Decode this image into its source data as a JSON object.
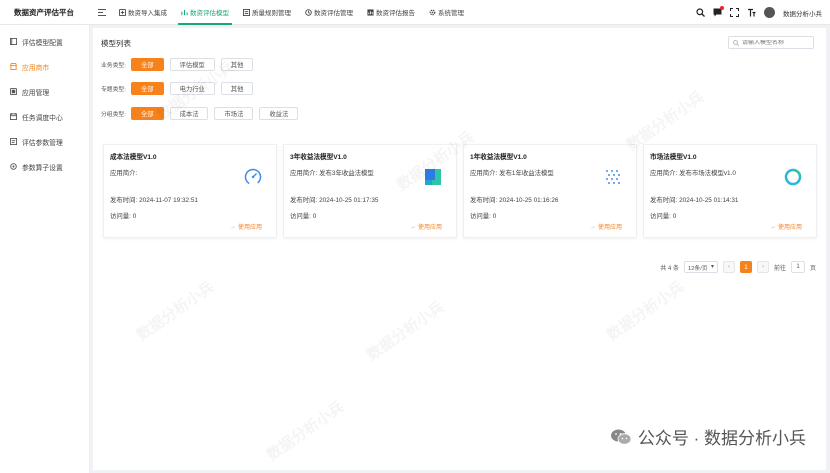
{
  "app": {
    "title": "数据资产评估平台"
  },
  "nav": [
    {
      "label": "数资导入集成",
      "icon": "import-icon"
    },
    {
      "label": "数资评估模型",
      "icon": "model-icon"
    },
    {
      "label": "质量规则管理",
      "icon": "rule-icon"
    },
    {
      "label": "数资评估管理",
      "icon": "assess-icon"
    },
    {
      "label": "数资评估报告",
      "icon": "report-icon"
    },
    {
      "label": "系统管理",
      "icon": "system-icon"
    }
  ],
  "user": {
    "name": "数据分析小兵"
  },
  "sidebar": [
    {
      "label": "评估模型配置",
      "icon": "config-icon"
    },
    {
      "label": "应用商市",
      "icon": "store-icon"
    },
    {
      "label": "应用管理",
      "icon": "app-icon"
    },
    {
      "label": "任务调度中心",
      "icon": "schedule-icon"
    },
    {
      "label": "评估参数管理",
      "icon": "param-icon"
    },
    {
      "label": "参数算子设置",
      "icon": "operator-icon"
    }
  ],
  "main": {
    "title": "模型列表",
    "search_placeholder": "请输入模型名称",
    "filters": [
      {
        "label": "业务类型:",
        "options": [
          "全部",
          "评估模型",
          "其他"
        ]
      },
      {
        "label": "专题类型:",
        "options": [
          "全部",
          "电力行业",
          "其他"
        ]
      },
      {
        "label": "分组类型:",
        "options": [
          "全部",
          "成本法",
          "市场法",
          "收益法"
        ]
      }
    ],
    "cards": [
      {
        "title": "成本法模型V1.0",
        "intro": "应用简介:",
        "time": "发布时间:  2024-11-07 19:32:51",
        "visits": "访问量:  0",
        "action": "使用应用",
        "icon": "gauge-icon"
      },
      {
        "title": "3年收益法模型V1.0",
        "intro": "应用简介:  发布3年收益法模型",
        "time": "发布时间:  2024-10-25 01:17:35",
        "visits": "访问量:  0",
        "action": "使用应用",
        "icon": "blocks-icon"
      },
      {
        "title": "1年收益法模型V1.0",
        "intro": "应用简介:  发布1年收益法模型",
        "time": "发布时间:  2024-10-25 01:16:26",
        "visits": "访问量:  0",
        "action": "使用应用",
        "icon": "dots-icon"
      },
      {
        "title": "市场法模型V1.0",
        "intro": "应用简介:  发布市场法模型v1.0",
        "time": "发布时间:  2024-10-25 01:14:31",
        "visits": "访问量:  0",
        "action": "使用应用",
        "icon": "ring-icon"
      }
    ],
    "pagination": {
      "total": "共 4 条",
      "page_size": "12条/页",
      "current": "1",
      "goto_label": "前往",
      "goto_value": "1",
      "page_suffix": "页"
    }
  },
  "watermark": "数据分析小兵",
  "footer": "公众号 · 数据分析小兵",
  "colors": {
    "accent": "#f7821b",
    "nav_active": "#19a974"
  }
}
